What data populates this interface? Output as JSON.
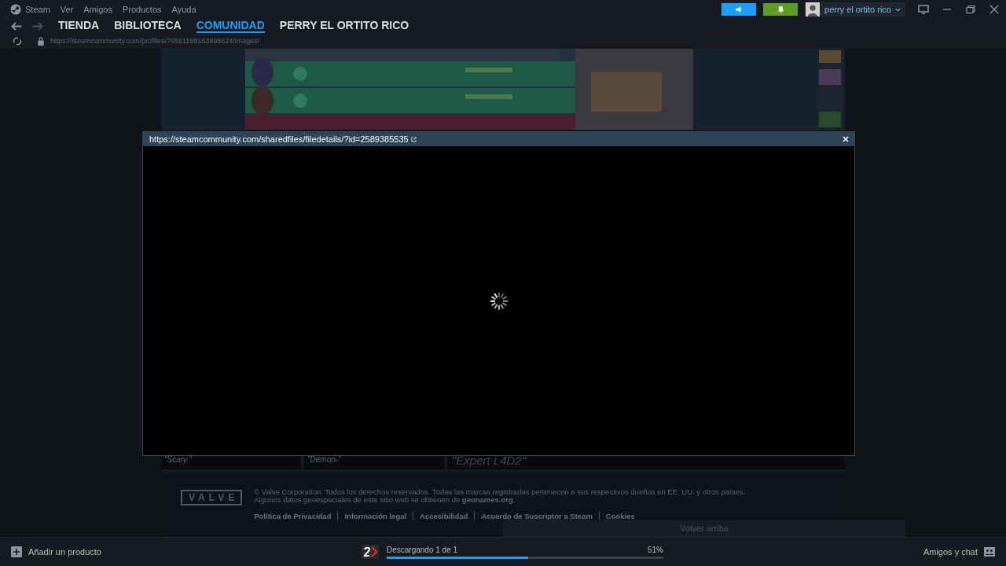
{
  "menu": [
    "Steam",
    "Ver",
    "Amigos",
    "Productos",
    "Ayuda"
  ],
  "nav_tabs": [
    {
      "label": "TIENDA",
      "selected": false
    },
    {
      "label": "BIBLIOTECA",
      "selected": false
    },
    {
      "label": "COMUNIDAD",
      "selected": true
    },
    {
      "label": "PERRY EL ORTITO RICO",
      "selected": false
    }
  ],
  "address": "https://steamcommunity.com/profiles/76561198163898624/images/",
  "account": {
    "name": "perry el ortito rico"
  },
  "background_page": {
    "captions": [
      "\"Scary.\"",
      "\"Demon-\"",
      "\"Expert L4D2\""
    ],
    "footer": {
      "logo": "VALVE",
      "copyright": "© Valve Corporation. Todos los derechos reservados. Todas las marcas registradas pertenecen a sus respectivos dueños en EE. UU. y otros países.",
      "geo_note": "Algunos datos geoespaciales de este sitio web se obtienen de **geonames.org**.",
      "links": [
        "Política de Privacidad",
        "Información legal",
        "Accesibilidad",
        "Acuerdo de Suscriptor a Steam",
        "Cookies"
      ]
    },
    "back_to_top": "Volver arriba"
  },
  "modal": {
    "url": "https://steamcommunity.com/sharedfiles/filedetails/?id=2589385535",
    "loading": true
  },
  "bottom_bar": {
    "add_product": "Añadir un producto",
    "download": {
      "status": "Descargando 1 de 1",
      "level": 0.51,
      "percent": "51%"
    },
    "friends": "Amigos y chat"
  }
}
